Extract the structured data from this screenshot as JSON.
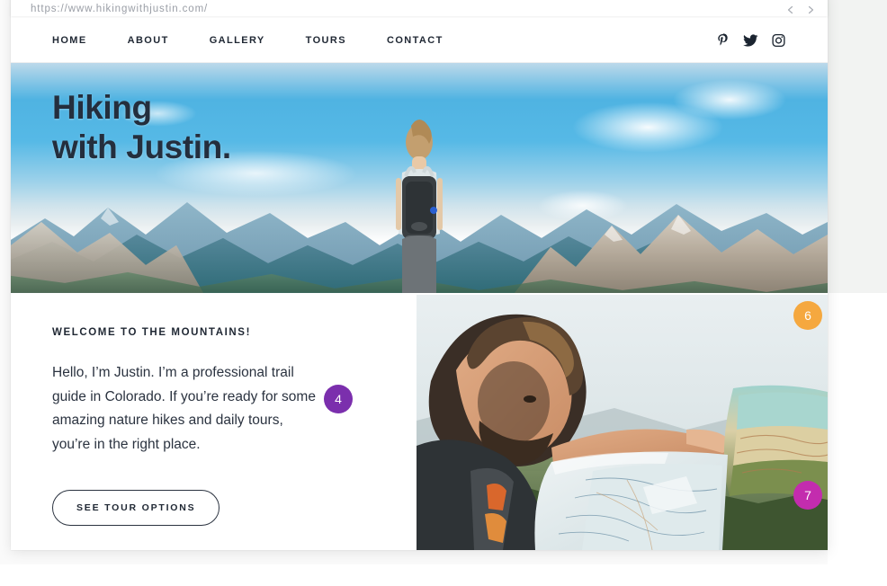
{
  "browser": {
    "url": "https://www.hikingwithjustin.com/",
    "nav_back_icon": "chevron-left-icon",
    "nav_forward_icon": "chevron-right-icon"
  },
  "site_nav": {
    "links": [
      {
        "label": "HOME"
      },
      {
        "label": "ABOUT"
      },
      {
        "label": "GALLERY"
      },
      {
        "label": "TOURS"
      },
      {
        "label": "CONTACT"
      }
    ],
    "social": [
      {
        "name": "pinterest-icon"
      },
      {
        "name": "twitter-icon"
      },
      {
        "name": "instagram-icon"
      }
    ]
  },
  "hero": {
    "title": "Hiking\nwith Justin.",
    "image_alt": "hiker-with-backpack-overlooking-mountains"
  },
  "intro": {
    "eyebrow": "WELCOME TO THE MOUNTAINS!",
    "body": "Hello, I’m Justin. I’m a professional trail guide in Colorado. If you’re ready for some amazing nature hikes and daily tours, you’re in the right place.",
    "cta_label": "SEE TOUR OPTIONS"
  },
  "photo": {
    "image_alt": "hiker-reading-a-paper-map"
  },
  "badges": [
    {
      "label": "4",
      "color": "#7b2fad"
    },
    {
      "label": "6",
      "color": "#f5a83f"
    },
    {
      "label": "7",
      "color": "#c32cae"
    }
  ],
  "colors": {
    "text_dark": "#1f2733",
    "url_gray": "#9a9ea6",
    "badge_purple": "#7b2fad",
    "badge_orange": "#f5a83f",
    "badge_magenta": "#c32cae",
    "page_bg": "#ffffff",
    "panel_gray": "#f2f3f2"
  }
}
